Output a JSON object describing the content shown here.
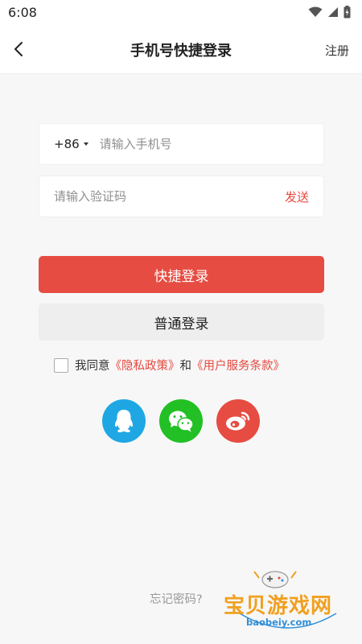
{
  "status_bar": {
    "time": "6:08"
  },
  "header": {
    "title": "手机号快捷登录",
    "register_label": "注册"
  },
  "phone_field": {
    "country_code": "+86",
    "placeholder": "请输入手机号",
    "value": ""
  },
  "code_field": {
    "placeholder": "请输入验证码",
    "value": "",
    "send_label": "发送"
  },
  "buttons": {
    "quick_login": "快捷登录",
    "normal_login": "普通登录"
  },
  "agreement": {
    "prefix": "我同意",
    "privacy_link": "《隐私政策》",
    "joiner": "和",
    "terms_link": "《用户服务条款》",
    "checked": false
  },
  "social_icons": [
    "qq-icon",
    "wechat-icon",
    "weibo-icon"
  ],
  "forgot_password": "忘记密码?",
  "watermark": {
    "text": "宝贝游戏网",
    "url": "baobeiy.com"
  },
  "colors": {
    "accent": "#e64c42",
    "qq": "#1fa7e4",
    "wechat": "#22c024",
    "weibo": "#e64c42"
  }
}
